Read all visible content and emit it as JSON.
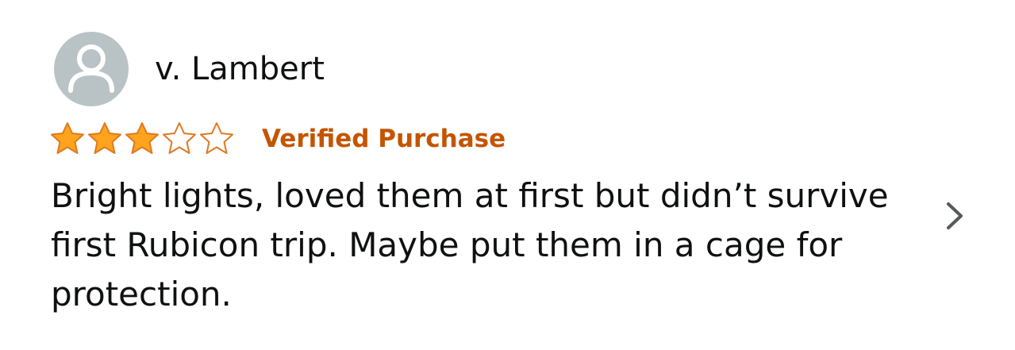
{
  "review": {
    "reviewer_name": "v. Lambert",
    "avatar_icon": "default-user-icon",
    "rating": 3,
    "rating_max": 5,
    "star_color": "#ffa41c",
    "star_outline_color": "#de7921",
    "verified_label": "Verified Purchase",
    "verified_color": "#c45500",
    "body": "Bright lights, loved them at first but didn’t survive first Rubicon trip. Maybe put them in a cage for protection.",
    "next_icon": "chevron-right-icon"
  }
}
